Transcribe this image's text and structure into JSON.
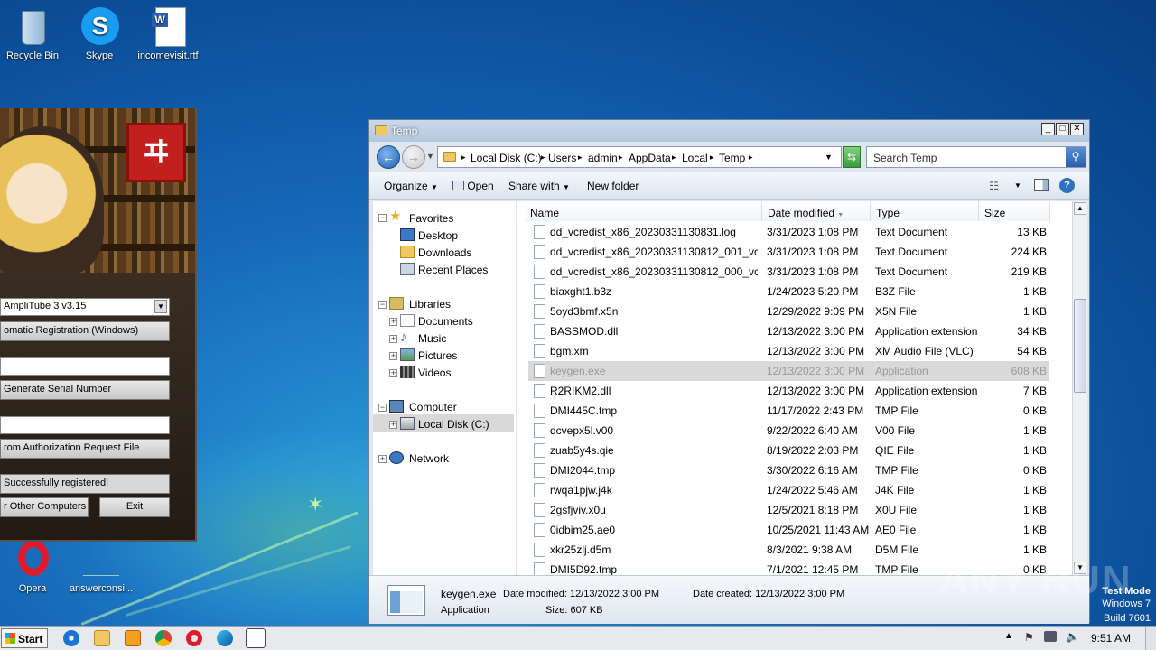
{
  "desktop": {
    "icons": {
      "recycle_bin": "Recycle Bin",
      "skype": "Skype",
      "incomevisit": "incomevisit.rtf",
      "opera": "Opera",
      "answerconsi": "answerconsi..."
    }
  },
  "keygen": {
    "product_select": "AmpliTube 3 v3.15",
    "registration_button": "omatic Registration (Windows)",
    "generate_button": "Generate Serial Number",
    "auth_request_button": "rom Authorization Request File",
    "status": "Successfully registered!",
    "other_computers_button": "r Other Computers",
    "exit_button": "Exit"
  },
  "explorer": {
    "title": "Temp",
    "breadcrumb": [
      "Local Disk (C:)",
      "Users",
      "admin",
      "AppData",
      "Local",
      "Temp"
    ],
    "search_placeholder": "Search Temp",
    "toolbar": {
      "organize": "Organize",
      "open": "Open",
      "share_with": "Share with",
      "new_folder": "New folder"
    },
    "nav": {
      "favorites": "Favorites",
      "desktop": "Desktop",
      "downloads": "Downloads",
      "recent_places": "Recent Places",
      "libraries": "Libraries",
      "documents": "Documents",
      "music": "Music",
      "pictures": "Pictures",
      "videos": "Videos",
      "computer": "Computer",
      "local_disk": "Local Disk (C:)",
      "network": "Network"
    },
    "columns": {
      "name": "Name",
      "date": "Date modified",
      "type": "Type",
      "size": "Size"
    },
    "files": [
      {
        "name": "dd_vcredist_x86_20230331130831.log",
        "date": "3/31/2023 1:08 PM",
        "type": "Text Document",
        "size": "13 KB"
      },
      {
        "name": "dd_vcredist_x86_20230331130812_001_vc...",
        "date": "3/31/2023 1:08 PM",
        "type": "Text Document",
        "size": "224 KB"
      },
      {
        "name": "dd_vcredist_x86_20230331130812_000_vc...",
        "date": "3/31/2023 1:08 PM",
        "type": "Text Document",
        "size": "219 KB"
      },
      {
        "name": "biaxght1.b3z",
        "date": "1/24/2023 5:20 PM",
        "type": "B3Z File",
        "size": "1 KB"
      },
      {
        "name": "5oyd3bmf.x5n",
        "date": "12/29/2022 9:09 PM",
        "type": "X5N File",
        "size": "1 KB"
      },
      {
        "name": "BASSMOD.dll",
        "date": "12/13/2022 3:00 PM",
        "type": "Application extension",
        "size": "34 KB"
      },
      {
        "name": "bgm.xm",
        "date": "12/13/2022 3:00 PM",
        "type": "XM Audio File (VLC)",
        "size": "54 KB"
      },
      {
        "name": "keygen.exe",
        "date": "12/13/2022 3:00 PM",
        "type": "Application",
        "size": "608 KB"
      },
      {
        "name": "R2RIKM2.dll",
        "date": "12/13/2022 3:00 PM",
        "type": "Application extension",
        "size": "7 KB"
      },
      {
        "name": "DMI445C.tmp",
        "date": "11/17/2022 2:43 PM",
        "type": "TMP File",
        "size": "0 KB"
      },
      {
        "name": "dcvepx5l.v00",
        "date": "9/22/2022 6:40 AM",
        "type": "V00 File",
        "size": "1 KB"
      },
      {
        "name": "zuab5y4s.qie",
        "date": "8/19/2022 2:03 PM",
        "type": "QIE File",
        "size": "1 KB"
      },
      {
        "name": "DMI2044.tmp",
        "date": "3/30/2022 6:16 AM",
        "type": "TMP File",
        "size": "0 KB"
      },
      {
        "name": "rwqa1pjw.j4k",
        "date": "1/24/2022 5:46 AM",
        "type": "J4K File",
        "size": "1 KB"
      },
      {
        "name": "2gsfjviv.x0u",
        "date": "12/5/2021 8:18 PM",
        "type": "X0U File",
        "size": "1 KB"
      },
      {
        "name": "0idbim25.ae0",
        "date": "10/25/2021 11:43 AM",
        "type": "AE0 File",
        "size": "1 KB"
      },
      {
        "name": "xkr25zlj.d5m",
        "date": "8/3/2021 9:38 AM",
        "type": "D5M File",
        "size": "1 KB"
      },
      {
        "name": "DMI5D92.tmp",
        "date": "7/1/2021 12:45 PM",
        "type": "TMP File",
        "size": "0 KB"
      }
    ],
    "selected_index": 7,
    "details": {
      "name": "keygen.exe",
      "date_modified": "Date modified: 12/13/2022 3:00 PM",
      "date_created": "Date created: 12/13/2022 3:00 PM",
      "type": "Application",
      "size": "Size: 607 KB"
    }
  },
  "taskbar": {
    "start": "Start",
    "clock": "9:51 AM"
  },
  "watermark": "ANY RUN",
  "test_mode": {
    "line1": "Test Mode",
    "line2": "Windows 7",
    "line3": "Build 7601"
  }
}
